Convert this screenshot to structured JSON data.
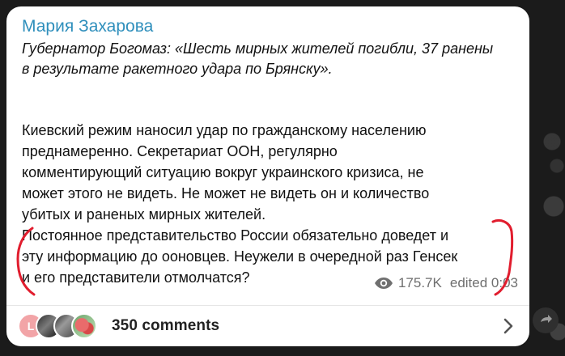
{
  "post": {
    "author": "Мария Захарова",
    "quote": "Губернатор Богомаз: «Шесть мирных жителей погибли, 37 ранены\nв результате ракетного удара по Брянску».",
    "body": "Киевский режим наносил удар по гражданскому населению\nпреднамеренно. Секретариат ООН, регулярно\nкомментирующий ситуацию вокруг украинского кризиса, не\nможет этого не видеть. Не может не видеть он и количество\nубитых и раненых мирных жителей.\nПостоянное представительство России  обязательно доведет и\nэту информацию до ооновцев. Неужели в очередной раз Генсек\nи его представители отмолчатся?",
    "views": "175.7K",
    "edited": "edited 0:03"
  },
  "comments": {
    "label": "350 comments",
    "avatar_initial": "L"
  },
  "icons": {
    "views": "eye-icon",
    "open_comments": "chevron-right-icon",
    "side_action": "share-icon"
  },
  "colors": {
    "author": "#2f8fbc",
    "annotation": "#e11d2e",
    "background": "#1b1b1b",
    "bubble": "#ffffff"
  }
}
